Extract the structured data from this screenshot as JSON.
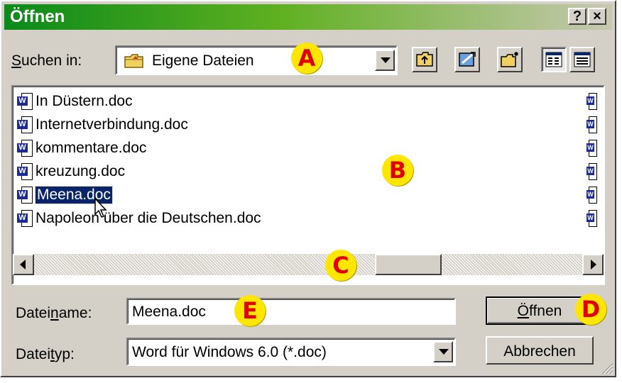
{
  "window": {
    "title": "Öffnen",
    "help_label": "?",
    "close_label": "×"
  },
  "lookin": {
    "label_prefix": "",
    "label_hotkey": "S",
    "label_rest": "uchen in:",
    "value": "Eigene Dateien"
  },
  "toolbar": {
    "icons": [
      "up-one-level-icon",
      "favorites-icon",
      "new-folder-icon",
      "list-view-icon",
      "details-view-icon"
    ]
  },
  "files": [
    {
      "name": "In Düstern.doc",
      "selected": false
    },
    {
      "name": "Internetverbindung.doc",
      "selected": false
    },
    {
      "name": "kommentare.doc",
      "selected": false
    },
    {
      "name": "kreuzung.doc",
      "selected": false
    },
    {
      "name": "Meena.doc",
      "selected": true
    },
    {
      "name": "Napoleon über die Deutschen.doc",
      "selected": false
    }
  ],
  "filename": {
    "label_prefix": "Datei",
    "label_hotkey": "n",
    "label_rest": "ame:",
    "value": "Meena.doc"
  },
  "filetype": {
    "label_prefix": "Datei",
    "label_hotkey": "t",
    "label_rest": "yp:",
    "value": "Word für Windows 6.0 (*.doc)"
  },
  "buttons": {
    "open_label": "Öffnen",
    "open_hotkey": "Ö",
    "open_rest": "ffnen",
    "cancel_label": "Abbrechen"
  },
  "annotations": [
    "A",
    "B",
    "C",
    "D",
    "E"
  ],
  "colors": {
    "titlebar_start": "#0a8a1a",
    "selection": "#0a246a",
    "badge_fill": "#ffe600",
    "badge_text": "#e00000"
  }
}
